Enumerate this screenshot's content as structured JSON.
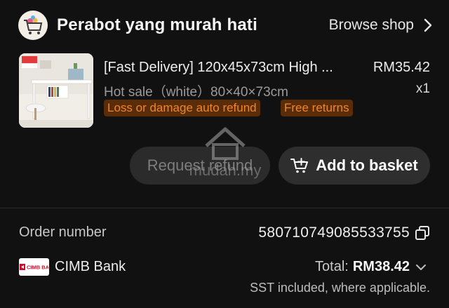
{
  "shop": {
    "name": "Perabot yang murah hati",
    "browse_label": "Browse shop"
  },
  "product": {
    "title": "[Fast Delivery] 120x45x73cm High ...",
    "price": "RM35.42",
    "variant": "Hot sale（white）80×40×73cm",
    "quantity": "x1",
    "tags": [
      "Loss or damage auto refund",
      "Free returns"
    ]
  },
  "actions": {
    "refund_label": "Request refund",
    "basket_label": "Add to basket"
  },
  "watermark": {
    "text": "mudah.my"
  },
  "order": {
    "number_label": "Order number",
    "number": "580710749085533755",
    "bank_logo_text": "CIMB BANK",
    "bank_name": "CIMB Bank",
    "total_label": "Total:",
    "total_amount": "RM38.42",
    "sst_note": "SST included, where applicable."
  },
  "colors": {
    "background": "#111111",
    "tag_background": "#5a2c07",
    "tag_text": "#f0852a",
    "button_background": "#2e2e2e",
    "bank_red": "#c8102e"
  }
}
